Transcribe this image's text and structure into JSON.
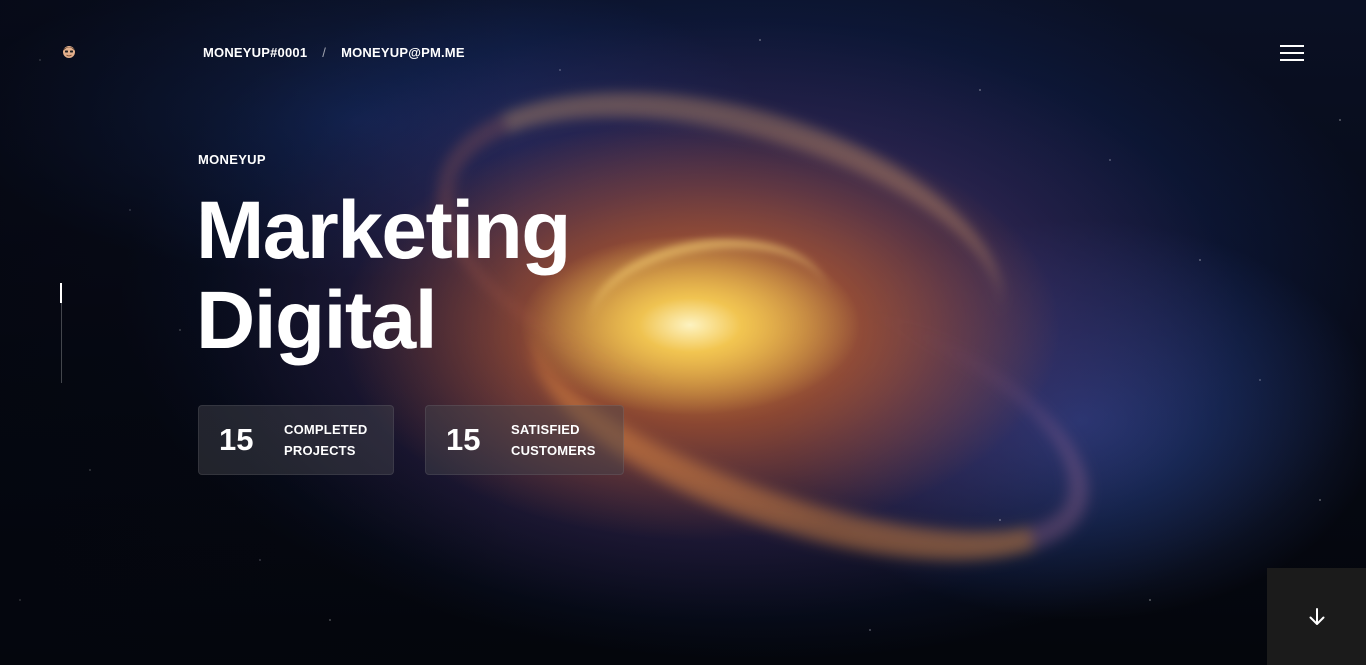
{
  "header": {
    "logo_icon": "avatar-emoji-icon",
    "contact_discord": "MONEYUP#0001",
    "separator": "/",
    "contact_email": "MONEYUP@PM.ME",
    "menu_icon": "hamburger-menu-icon"
  },
  "hero": {
    "eyebrow": "MONEYUP",
    "title_line1": "Marketing",
    "title_line2": "Digital"
  },
  "stats": [
    {
      "value": "15",
      "label_line1": "COMPLETED",
      "label_line2": "PROJECTS"
    },
    {
      "value": "15",
      "label_line1": "SATISFIED",
      "label_line2": "CUSTOMERS"
    }
  ],
  "scroll_down_icon": "arrow-down-icon",
  "colors": {
    "text": "#ffffff",
    "card_bg": "rgba(70,70,78,0.45)",
    "scroll_button_bg": "#1b1b1b"
  }
}
